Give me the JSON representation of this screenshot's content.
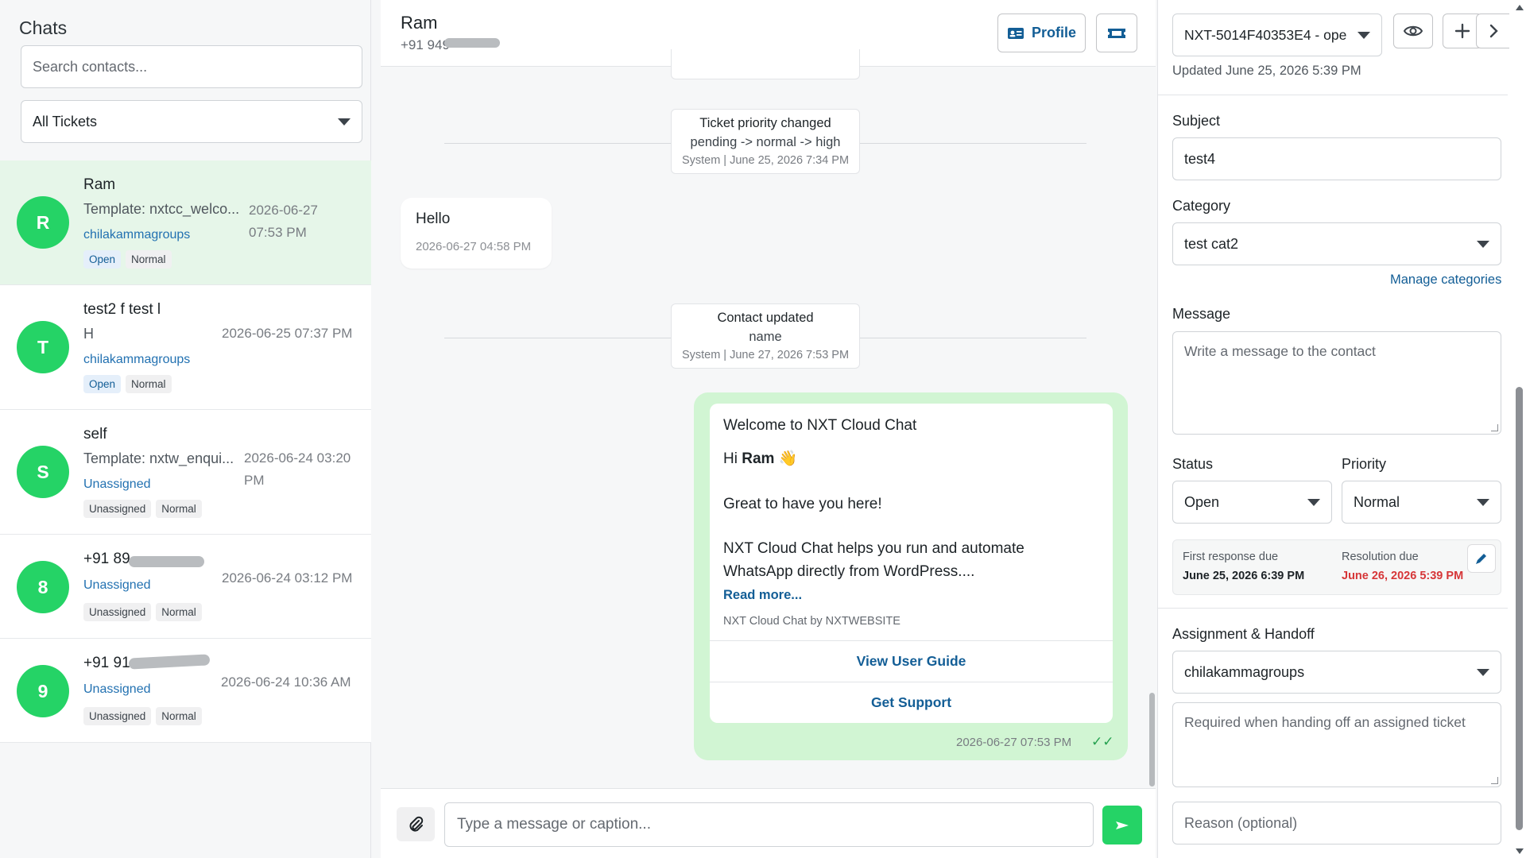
{
  "sidebar": {
    "title": "Chats",
    "search_placeholder": "Search contacts...",
    "filter_value": "All Tickets"
  },
  "chats": [
    {
      "initial": "R",
      "name": "Ram",
      "preview": "Template: nxtcc_welco...",
      "time_line1": "2026-06-27",
      "time_line2": "07:53 PM",
      "agent": "chilakammagroups",
      "badges": [
        "Open",
        "Normal"
      ]
    },
    {
      "initial": "T",
      "name": "test2 f test l",
      "preview": "H",
      "time": "2026-06-25 07:37 PM",
      "agent": "chilakammagroups",
      "badges": [
        "Open",
        "Normal"
      ]
    },
    {
      "initial": "S",
      "name": "self",
      "preview": "Template: nxtw_enqui...",
      "time_line1": "2026-06-24 03:20",
      "time_line2": "PM",
      "agent": "Unassigned",
      "badges": [
        "Unassigned",
        "Normal"
      ]
    },
    {
      "initial": "8",
      "name": "+91 89",
      "time": "2026-06-24 03:12 PM",
      "agent": "Unassigned",
      "badges": [
        "Unassigned",
        "Normal"
      ]
    },
    {
      "initial": "9",
      "name": "+91 91",
      "time": "2026-06-24 10:36 AM",
      "agent": "Unassigned",
      "badges": [
        "Unassigned",
        "Normal"
      ]
    }
  ],
  "chat": {
    "contact_name": "Ram",
    "contact_phone": "+91 949",
    "profile_label": "Profile",
    "system_events": [
      {
        "title": "Ticket priority changed",
        "body": "pending -> normal -> high",
        "meta": "System | June 25, 2026 7:34 PM"
      },
      {
        "title": "Contact updated",
        "body": "name",
        "meta": "System | June 27, 2026 7:53 PM"
      }
    ],
    "incoming": {
      "text": "Hello",
      "time": "2026-06-27 04:58 PM"
    },
    "template": {
      "header": "Welcome to NXT Cloud Chat",
      "greeting_prefix": "Hi ",
      "greeting_name": "Ram",
      "greeting_emoji": "👋",
      "line2": "Great to have you here!",
      "line3": "NXT Cloud Chat helps you run and automate WhatsApp directly from WordPress....",
      "read_more": "Read more...",
      "footer": "NXT Cloud Chat by NXTWEBSITE",
      "button1": "View User Guide",
      "button2": "Get Support",
      "time": "2026-06-27 07:53 PM",
      "ticks": "✓✓"
    },
    "composer_placeholder": "Type a message or caption..."
  },
  "ticket": {
    "selected": "NXT-5014F40353E4 - ope",
    "updated": "Updated June 25, 2026 5:39 PM",
    "subject_label": "Subject",
    "subject_value": "test4",
    "category_label": "Category",
    "category_value": "test cat2",
    "manage_categories": "Manage categories",
    "message_label": "Message",
    "message_placeholder": "Write a message to the contact",
    "status_label": "Status",
    "status_value": "Open",
    "priority_label": "Priority",
    "priority_value": "Normal",
    "first_response_label": "First response due",
    "first_response_value": "June 25, 2026 6:39 PM",
    "resolution_label": "Resolution due",
    "resolution_value": "June 26, 2026 5:39 PM",
    "assignment_label": "Assignment & Handoff",
    "assignee_value": "chilakammagroups",
    "handoff_placeholder": "Required when handing off an assigned ticket",
    "reason_placeholder": "Reason (optional)"
  },
  "colors": {
    "brand_green": "#25d366",
    "link_blue": "#135e96",
    "overdue_red": "#d63638",
    "active_row": "#e6f6e9",
    "outgoing_bubble": "#d1f5d3"
  }
}
